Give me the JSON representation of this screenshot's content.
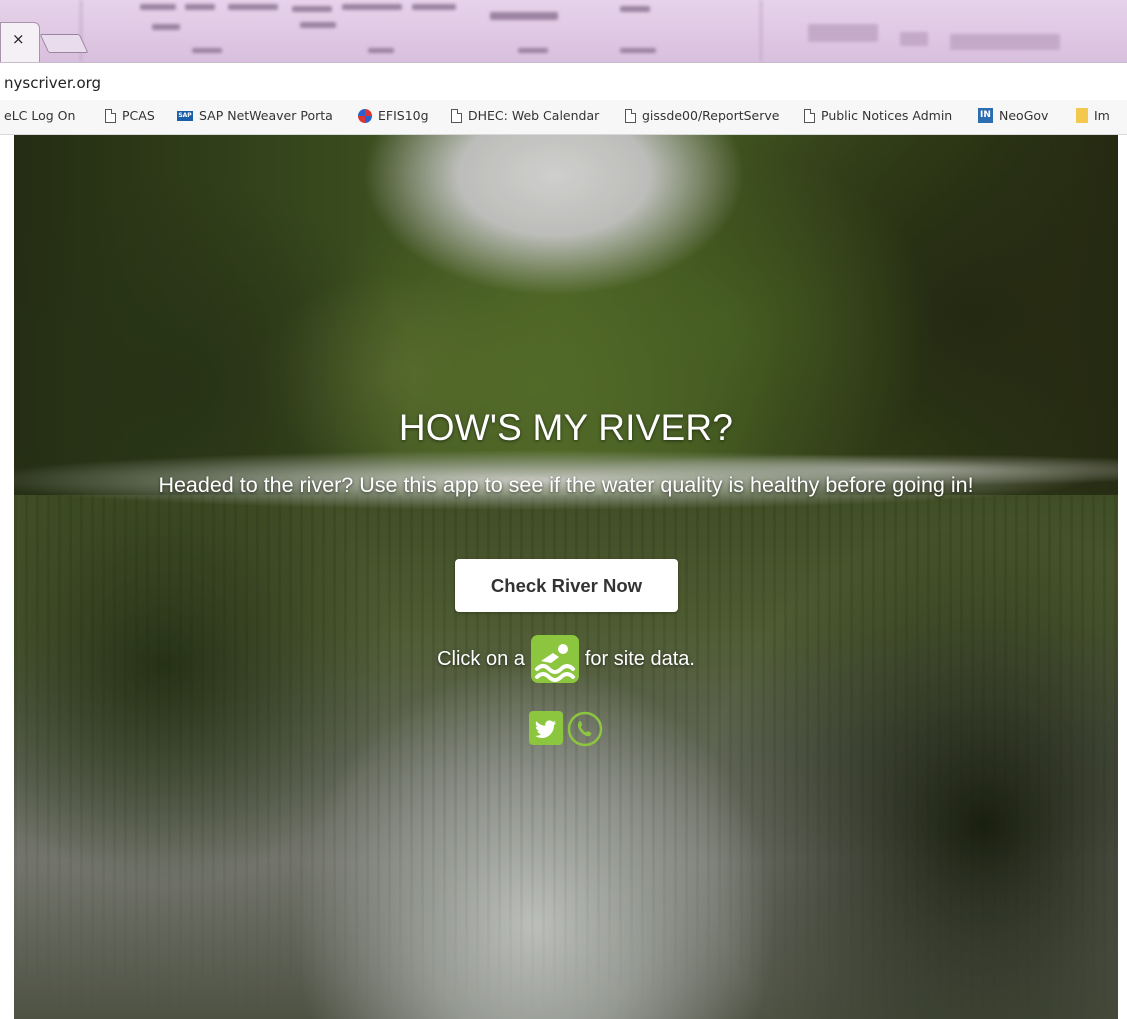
{
  "browser": {
    "tab_close": "×",
    "url": "nyscriver.org",
    "bookmarks": [
      {
        "label": "eLC Log On",
        "icon": "none"
      },
      {
        "label": "PCAS",
        "icon": "document-icon"
      },
      {
        "label": "SAP NetWeaver Porta",
        "icon": "sap-icon"
      },
      {
        "label": "EFIS10g",
        "icon": "globe-icon"
      },
      {
        "label": "DHEC: Web Calendar",
        "icon": "document-icon"
      },
      {
        "label": "gissde00/ReportServe",
        "icon": "document-icon"
      },
      {
        "label": "Public Notices Admin",
        "icon": "document-icon"
      },
      {
        "label": "NeoGov",
        "icon": "in-icon"
      },
      {
        "label": "Im",
        "icon": "folder-icon"
      }
    ]
  },
  "hero": {
    "title": "HOW'S MY RIVER?",
    "subtitle": "Headed to the river? Use this app to see if the water quality is healthy before going in!",
    "cta_label": "Check River Now",
    "click_prefix": "Click on a",
    "click_suffix": "for site data.",
    "accent_color": "#8cc63f"
  },
  "social": {
    "icons": [
      "twitter-icon",
      "phone-icon"
    ]
  }
}
